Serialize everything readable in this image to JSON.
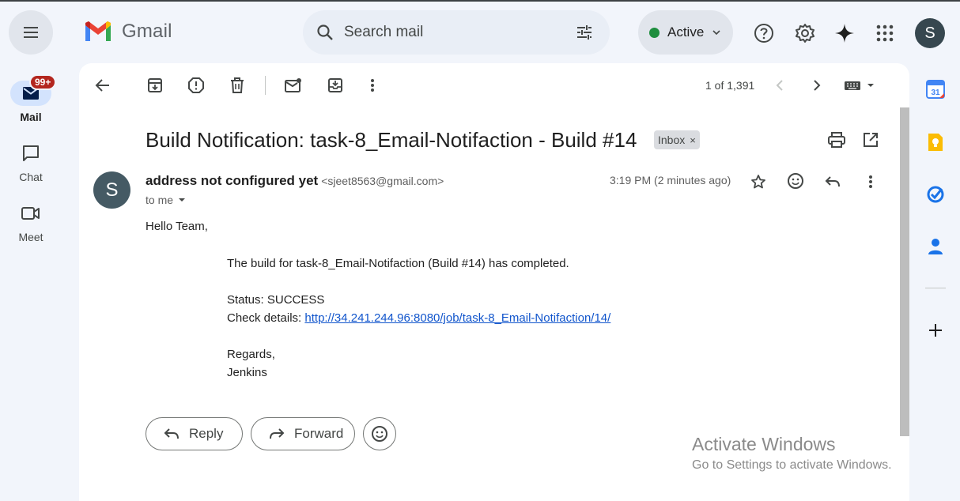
{
  "app": {
    "name": "Gmail"
  },
  "search": {
    "placeholder": "Search mail"
  },
  "status": {
    "label": "Active",
    "color": "#1e8e3e"
  },
  "account": {
    "initial": "S"
  },
  "rail": {
    "mail_label": "Mail",
    "mail_badge": "99+",
    "chat_label": "Chat",
    "meet_label": "Meet"
  },
  "pager": {
    "text": "1 of 1,391"
  },
  "message": {
    "subject": "Build Notification: task-8_Email-Notifaction - Build #14",
    "label": "Inbox",
    "label_remove": "×",
    "sender_initial": "S",
    "sender_name": "address not configured yet",
    "sender_email": "<sjeet8563@gmail.com>",
    "to": "to me",
    "time": "3:19 PM (2 minutes ago)",
    "body": {
      "greeting": "Hello Team,",
      "line1": "The build for task-8_Email-Notifaction (Build #14) has completed.",
      "status": "Status: SUCCESS",
      "details_prefix": "Check details: ",
      "details_link": "http://34.241.244.96:8080/job/task-8_Email-Notifaction/14/",
      "regards": "Regards,",
      "signature": "Jenkins"
    }
  },
  "actions": {
    "reply": "Reply",
    "forward": "Forward"
  },
  "watermark": {
    "title": "Activate Windows",
    "subtitle": "Go to Settings to activate Windows."
  },
  "colors": {
    "accent": "#0b57d0",
    "background": "#f2f5fb",
    "link": "#1155cc"
  }
}
